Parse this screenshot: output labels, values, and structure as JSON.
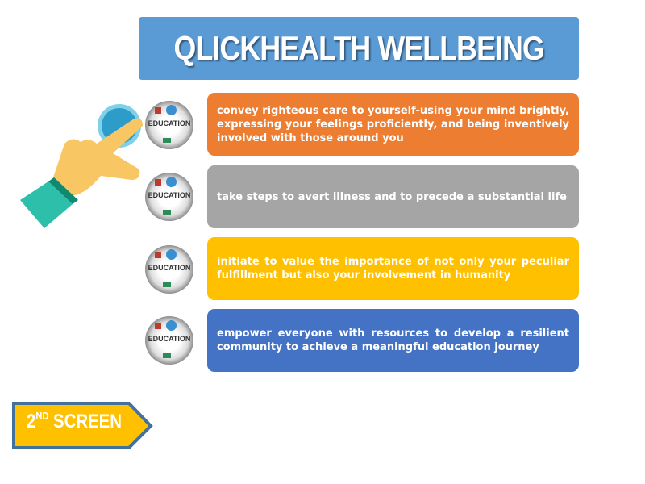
{
  "title": "QLICKHEALTH WELLBEING",
  "icon_label": "EDUCATION",
  "items": [
    {
      "text": "convey righteous care to yourself-using your mind brightly, expressing your feelings proficiently, and being inventively involved with those around you",
      "color": "#ed7d31"
    },
    {
      "text": "take steps to avert illness and to precede a substantial life",
      "color": "#a5a5a5"
    },
    {
      "text": "initiate to value the importance of not only your peculiar fulfillment but also your involvement in humanity",
      "color": "#ffc000"
    },
    {
      "text": "empower everyone with resources to develop a resilient community to achieve a meaningful education journey",
      "color": "#4472c4"
    }
  ],
  "next_button": {
    "number": "2",
    "suffix": "ND",
    "label": "SCREEN"
  }
}
